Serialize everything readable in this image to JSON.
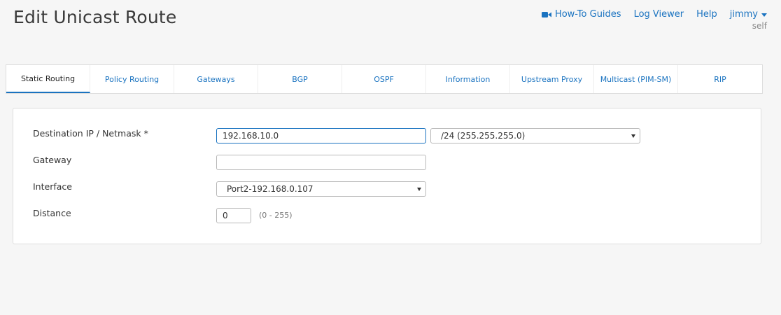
{
  "page": {
    "title": "Edit Unicast Route"
  },
  "header": {
    "howto_label": "How-To Guides",
    "logviewer_label": "Log Viewer",
    "help_label": "Help",
    "user_name": "jimmy",
    "user_role": "self",
    "icons": {
      "howto": "video-camera-icon",
      "user_menu": "caret-down-icon"
    },
    "link_color": "#1a73c0"
  },
  "tabs": [
    {
      "label": "Static Routing",
      "active": true
    },
    {
      "label": "Policy Routing",
      "active": false
    },
    {
      "label": "Gateways",
      "active": false
    },
    {
      "label": "BGP",
      "active": false
    },
    {
      "label": "OSPF",
      "active": false
    },
    {
      "label": "Information",
      "active": false
    },
    {
      "label": "Upstream Proxy",
      "active": false
    },
    {
      "label": "Multicast (PIM-SM)",
      "active": false
    },
    {
      "label": "RIP",
      "active": false
    }
  ],
  "form": {
    "destination": {
      "label": "Destination IP / Netmask *",
      "value": "192.168.10.0",
      "netmask": "/24 (255.255.255.0)"
    },
    "gateway": {
      "label": "Gateway",
      "value": ""
    },
    "interface": {
      "label": "Interface",
      "value": "Port2-192.168.0.107"
    },
    "distance": {
      "label": "Distance",
      "value": "0",
      "hint": "(0 - 255)"
    }
  }
}
